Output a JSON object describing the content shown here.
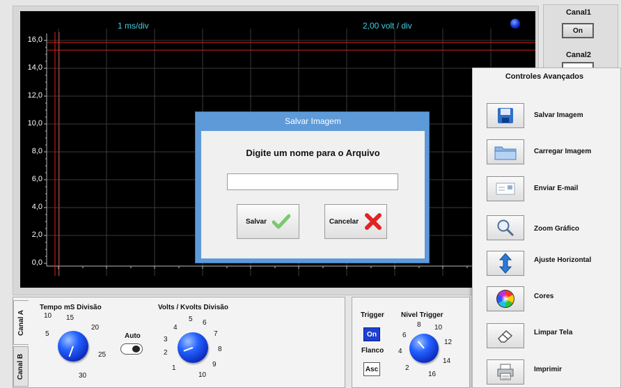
{
  "scope": {
    "time_div_label": "1 ms/div",
    "volt_div_label": "2,00 volt / div",
    "y_ticks": [
      "16,0",
      "14,0",
      "12,0",
      "10,0",
      "8,0",
      "6,0",
      "4,0",
      "2,0",
      "0,0"
    ]
  },
  "channels": {
    "canal1_label": "Canal1",
    "canal1_button": "On",
    "canal2_label": "Canal2"
  },
  "advanced": {
    "title": "Controles Avançados",
    "items": [
      {
        "label": "Salvar Imagem",
        "icon": "floppy-disk-icon"
      },
      {
        "label": "Carregar Imagem",
        "icon": "folder-icon"
      },
      {
        "label": "Enviar E-mail",
        "icon": "envelope-icon"
      },
      {
        "label": "Zoom Gráfico",
        "icon": "magnifier-icon"
      },
      {
        "label": "Ajuste Horizontal",
        "icon": "vertical-arrows-icon"
      },
      {
        "label": "Cores",
        "icon": "color-wheel-icon"
      },
      {
        "label": "Limpar Tela",
        "icon": "eraser-icon"
      },
      {
        "label": "Imprimir",
        "icon": "printer-icon"
      }
    ]
  },
  "tabs": {
    "canal_a": "Canal A",
    "canal_b": "Canal B"
  },
  "time_knob": {
    "title": "Tempo mS Divisão",
    "scale": [
      "5",
      "10",
      "15",
      "20",
      "25",
      "30"
    ]
  },
  "auto": {
    "label": "Auto"
  },
  "volts_knob": {
    "title": "Volts / Kvolts Divisão",
    "scale": [
      "1",
      "2",
      "3",
      "4",
      "5",
      "6",
      "7",
      "8",
      "9",
      "10"
    ]
  },
  "trigger": {
    "title": "Trigger",
    "button": "On",
    "flanco_label": "Flanco",
    "flanco_button": "Asc"
  },
  "nivel_trigger": {
    "title": "Nivel Trigger",
    "scale": [
      "2",
      "4",
      "6",
      "8",
      "10",
      "12",
      "14",
      "16"
    ]
  },
  "dialog": {
    "title": "Salvar Imagem",
    "prompt": "Digite um nome para o Arquivo",
    "input_value": "",
    "save_label": "Salvar",
    "cancel_label": "Cancelar"
  },
  "colors": {
    "scope_bg": "#000000",
    "grid": "#3a3a3a",
    "trace": "#e02020",
    "header_text": "#3fd0e6",
    "dialog_frame": "#5e9ad8",
    "knob_blue": "#1f5bff"
  }
}
